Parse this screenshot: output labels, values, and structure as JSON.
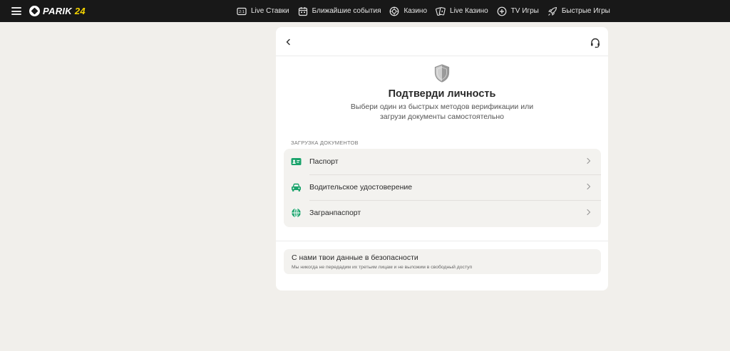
{
  "topbar": {
    "logo_text": "PARIK",
    "logo_num": "24",
    "nav": [
      {
        "label": "Live Ставки",
        "icon": "live-icon"
      },
      {
        "label": "Ближайшие события",
        "icon": "calendar-icon"
      },
      {
        "label": "Казино",
        "icon": "casino-chip-icon"
      },
      {
        "label": "Live Казино",
        "icon": "cards-icon"
      },
      {
        "label": "TV Игры",
        "icon": "tv-games-icon"
      },
      {
        "label": "Быстрые Игры",
        "icon": "rocket-icon"
      }
    ]
  },
  "verification": {
    "title": "Подтверди личность",
    "subtitle": "Выбери один из быстрых методов верификации или загрузи документы самостоятельно",
    "section_label": "ЗАГРУЗКА ДОКУМЕНТОВ",
    "documents": [
      {
        "label": "Паспорт",
        "icon": "id-card-icon"
      },
      {
        "label": "Водительское удостоверение",
        "icon": "car-icon"
      },
      {
        "label": "Загранпаспорт",
        "icon": "globe-icon"
      }
    ],
    "safety_title": "С нами твои данные в безопасности",
    "safety_text": "Мы никогда не передадим их третьим лицам и не выложим в свободный доступ"
  },
  "colors": {
    "accent": "#1aa36b",
    "topbar": "#181818",
    "logo_yellow": "#f5d400",
    "background": "#f1efeb"
  }
}
